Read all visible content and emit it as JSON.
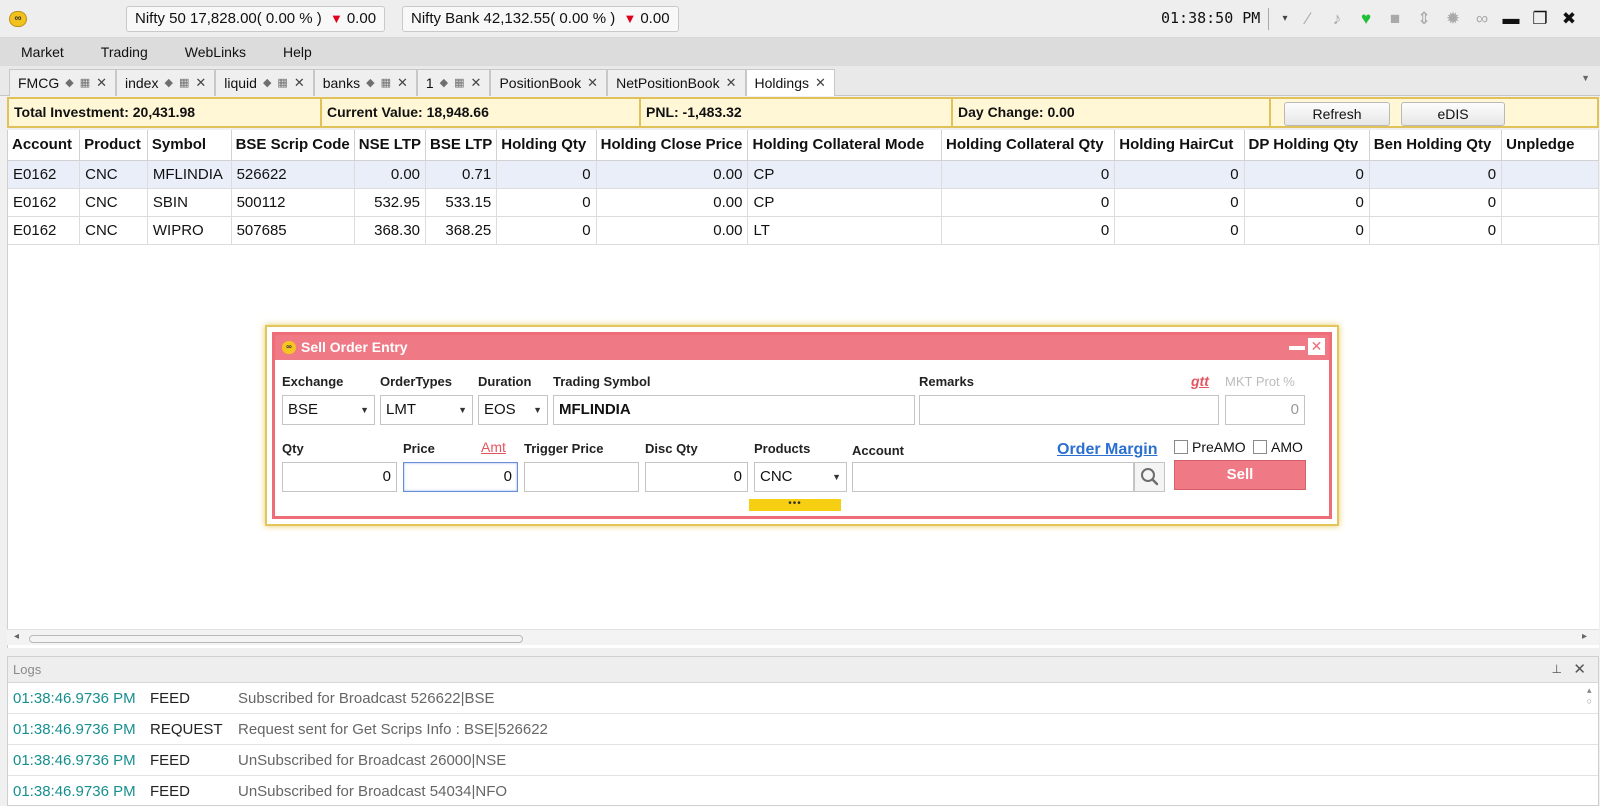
{
  "app": {
    "logo_text": "∞",
    "clock": "01:38:50 PM"
  },
  "tickers": [
    {
      "name": "Nifty 50",
      "value": "17,828.00",
      "change_pct": "( 0.00 % )",
      "change": "0.00"
    },
    {
      "name": "Nifty Bank",
      "value": "42,132.55",
      "change_pct": "( 0.00 % )",
      "change": "0.00"
    }
  ],
  "toolbar_icons": [
    "dropdown-arrow-icon",
    "magic-wand-icon",
    "bell-icon",
    "heartbeat-icon",
    "lock-icon",
    "sort-icon",
    "gear-icon",
    "link-icon",
    "minimize-icon",
    "restore-icon",
    "close-icon"
  ],
  "menu": [
    "Market",
    "Trading",
    "WebLinks",
    "Help"
  ],
  "tabs": [
    {
      "label": "FMCG",
      "sortable": true
    },
    {
      "label": "index",
      "sortable": true
    },
    {
      "label": "liquid",
      "sortable": true
    },
    {
      "label": "banks",
      "sortable": true
    },
    {
      "label": "1",
      "sortable": true
    },
    {
      "label": "PositionBook",
      "sortable": false
    },
    {
      "label": "NetPositionBook",
      "sortable": false
    },
    {
      "label": "Holdings",
      "sortable": false,
      "active": true
    }
  ],
  "summary": {
    "total_investment": "Total Investment: 20,431.98",
    "current_value": "Current Value: 18,948.66",
    "pnl": "PNL: -1,483.32",
    "day_change": "Day Change: 0.00",
    "refresh": "Refresh",
    "edis": "eDIS"
  },
  "holdings": {
    "columns": [
      "Account",
      "Product",
      "Symbol",
      "BSE Scrip Code",
      "NSE LTP",
      "BSE LTP",
      "Holding Qty",
      "Holding Close Price",
      "Holding Collateral Mode",
      "Holding Collateral Qty",
      "Holding HairCut",
      "DP Holding Qty",
      "Ben Holding Qty",
      "Unpledge"
    ],
    "rows": [
      [
        "E0162",
        "CNC",
        "MFLINDIA",
        "526622",
        "0.00",
        "0.71",
        "0",
        "0.00",
        "CP",
        "0",
        "0",
        "0",
        "0",
        ""
      ],
      [
        "E0162",
        "CNC",
        "SBIN",
        "500112",
        "532.95",
        "533.15",
        "0",
        "0.00",
        "CP",
        "0",
        "0",
        "0",
        "0",
        ""
      ],
      [
        "E0162",
        "CNC",
        "WIPRO",
        "507685",
        "368.30",
        "368.25",
        "0",
        "0.00",
        "LT",
        "0",
        "0",
        "0",
        "0",
        ""
      ]
    ]
  },
  "order_dialog": {
    "title": "Sell Order Entry",
    "labels": {
      "exchange": "Exchange",
      "order_types": "OrderTypes",
      "duration": "Duration",
      "trading_symbol": "Trading Symbol",
      "remarks": "Remarks",
      "gtt": "gtt",
      "mkt_prot": "MKT Prot %",
      "qty": "Qty",
      "price": "Price",
      "amt": "Amt",
      "trigger_price": "Trigger Price",
      "disc_qty": "Disc Qty",
      "products": "Products",
      "account": "Account",
      "order_margin": "Order Margin",
      "preamo": "PreAMO",
      "amo": "AMO"
    },
    "values": {
      "exchange": "BSE",
      "order_type": "LMT",
      "duration": "EOS",
      "trading_symbol": "MFLINDIA",
      "remarks": "",
      "mkt_prot": "0",
      "qty": "0",
      "price": "0",
      "trigger_price": "",
      "disc_qty": "0",
      "product": "CNC",
      "account": ""
    },
    "sell_button": "Sell",
    "more_indicator": "•••"
  },
  "logs": {
    "title": "Logs",
    "entries": [
      {
        "time": "01:38:46.9736 PM",
        "type": "FEED",
        "message": "Subscribed for Broadcast 526622|BSE"
      },
      {
        "time": "01:38:46.9736 PM",
        "type": "REQUEST",
        "message": "Request sent for Get Scrips Info : BSE|526622"
      },
      {
        "time": "01:38:46.9736 PM",
        "type": "FEED",
        "message": "UnSubscribed for Broadcast 26000|NSE"
      },
      {
        "time": "01:38:46.9736 PM",
        "type": "FEED",
        "message": "UnSubscribed for Broadcast 54034|NFO"
      }
    ]
  },
  "colors": {
    "accent_sell": "#ef7a85",
    "summary_bg": "#fff7d6",
    "summary_border": "#e1c15a",
    "down_arrow": "#e0001b",
    "log_time": "#178f8f",
    "link_blue": "#2b6fd1"
  }
}
